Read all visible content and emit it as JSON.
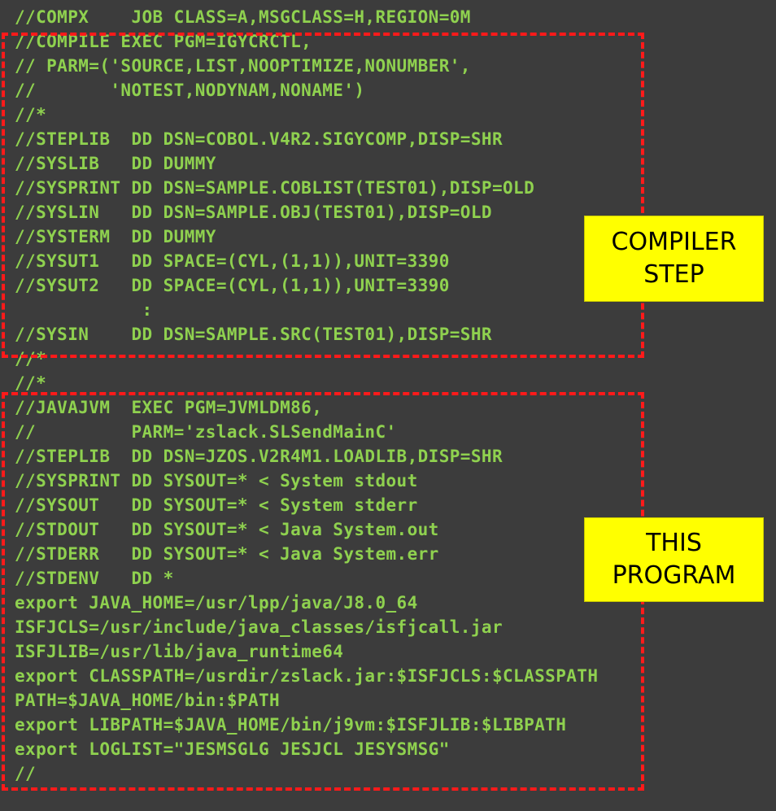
{
  "lines": [
    "//COMPX    JOB CLASS=A,MSGCLASS=H,REGION=0M",
    "//COMPILE EXEC PGM=IGYCRCTL,",
    "// PARM=('SOURCE,LIST,NOOPTIMIZE,NONUMBER',",
    "//       'NOTEST,NODYNAM,NONAME')",
    "//*",
    "//STEPLIB  DD DSN=COBOL.V4R2.SIGYCOMP,DISP=SHR",
    "//SYSLIB   DD DUMMY",
    "//SYSPRINT DD DSN=SAMPLE.COBLIST(TEST01),DISP=OLD",
    "//SYSLIN   DD DSN=SAMPLE.OBJ(TEST01),DISP=OLD",
    "//SYSTERM  DD DUMMY",
    "//SYSUT1   DD SPACE=(CYL,(1,1)),UNIT=3390",
    "//SYSUT2   DD SPACE=(CYL,(1,1)),UNIT=3390",
    "            :",
    "//SYSIN    DD DSN=SAMPLE.SRC(TEST01),DISP=SHR",
    "//*",
    "//*",
    "//JAVAJVM  EXEC PGM=JVMLDM86,",
    "//         PARM='zslack.SLSendMainC'",
    "//STEPLIB  DD DSN=JZOS.V2R4M1.LOADLIB,DISP=SHR",
    "//SYSPRINT DD SYSOUT=* < System stdout",
    "//SYSOUT   DD SYSOUT=* < System stderr",
    "//STDOUT   DD SYSOUT=* < Java System.out",
    "//STDERR   DD SYSOUT=* < Java System.err",
    "//STDENV   DD *",
    "export JAVA_HOME=/usr/lpp/java/J8.0_64",
    "ISFJCLS=/usr/include/java_classes/isfjcall.jar",
    "ISFJLIB=/usr/lib/java_runtime64",
    "export CLASSPATH=/usrdir/zslack.jar:$ISFJCLS:$CLASSPATH",
    "PATH=$JAVA_HOME/bin:$PATH",
    "export LIBPATH=$JAVA_HOME/bin/j9vm:$ISFJLIB:$LIBPATH",
    "export LOGLIST=\"JESMSGLG JESJCL JESYSMSG\"",
    "//"
  ],
  "callouts": {
    "compiler": {
      "line1": "COMPILER",
      "line2": "STEP"
    },
    "program": {
      "line1": "THIS",
      "line2": "PROGRAM"
    }
  },
  "colors": {
    "background": "#3c3c3c",
    "code_text": "#8fd14f",
    "highlight_border": "#ff1a1a",
    "callout_fill": "#ffff00"
  }
}
